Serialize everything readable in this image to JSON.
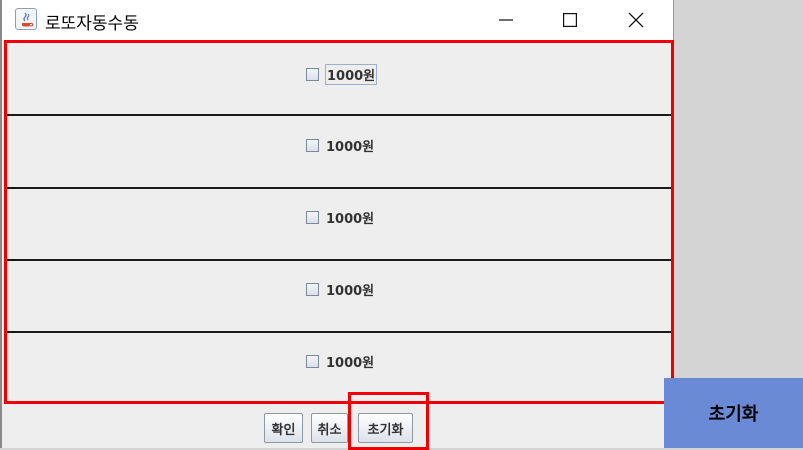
{
  "window": {
    "title": "로또자동수동",
    "controls": {
      "minimize_icon": "minimize-icon",
      "maximize_icon": "maximize-icon",
      "close_icon": "close-icon"
    }
  },
  "rows": [
    {
      "label": "1000원",
      "checked": false,
      "focused": true
    },
    {
      "label": "1000원",
      "checked": false,
      "focused": false
    },
    {
      "label": "1000원",
      "checked": false,
      "focused": false
    },
    {
      "label": "1000원",
      "checked": false,
      "focused": false
    },
    {
      "label": "1000원",
      "checked": false,
      "focused": false
    }
  ],
  "buttons": {
    "confirm": "확인",
    "cancel": "취소",
    "reset": "초기화"
  },
  "annotation": {
    "label": "초기화",
    "highlight_color": "#ee0000",
    "label_background": "#6a8ad6"
  }
}
